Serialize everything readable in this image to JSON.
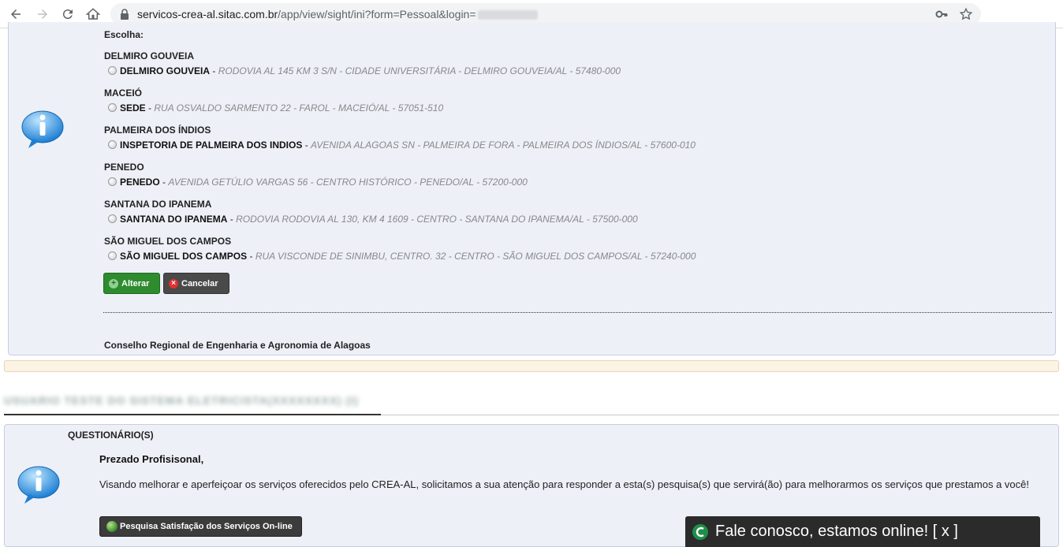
{
  "browser": {
    "url_host": "servicos-crea-al.sitac.com.br",
    "url_path": "/app/view/sight/ini?form=Pessoal&login="
  },
  "selection": {
    "prompt": "Escolha:",
    "groups": [
      {
        "city": "DELMIRO GOUVEIA",
        "name": "DELMIRO GOUVEIA",
        "address": "RODOVIA AL 145 KM 3 S/N - CIDADE UNIVERSITÁRIA - DELMIRO GOUVEIA/AL - 57480-000"
      },
      {
        "city": "MACEIÓ",
        "name": "SEDE",
        "address": "RUA OSVALDO SARMENTO 22 - FAROL - MACEIÓ/AL - 57051-510"
      },
      {
        "city": "PALMEIRA DOS ÍNDIOS",
        "name": "INSPETORIA DE PALMEIRA DOS INDIOS",
        "address": "AVENIDA ALAGOAS SN - PALMEIRA DE FORA - PALMEIRA DOS ÍNDIOS/AL - 57600-010"
      },
      {
        "city": "PENEDO",
        "name": "PENEDO",
        "address": "AVENIDA GETÚLIO VARGAS 56 - CENTRO HISTÓRICO - PENEDO/AL - 57200-000"
      },
      {
        "city": "SANTANA DO IPANEMA",
        "name": "SANTANA DO IPANEMA",
        "address": "RODOVIA RODOVIA AL 130, KM 4 1609 - CENTRO - SANTANA DO IPANEMA/AL - 57500-000"
      },
      {
        "city": "SÃO MIGUEL DOS CAMPOS",
        "name": "SÃO MIGUEL DOS CAMPOS",
        "address": "RUA VISCONDE DE SINIMBU, CENTRO. 32 - CENTRO - SÃO MIGUEL DOS CAMPOS/AL - 57240-000"
      }
    ],
    "separator": " - ",
    "alterar_label": "Alterar",
    "cancelar_label": "Cancelar",
    "footer": "Conselho Regional de Engenharia e Agronomia de Alagoas"
  },
  "blurred_heading": "USUARIO TESTE DO SISTEMA ELETRICISTA(XXXXXXXX) (I)",
  "questionario": {
    "title": "QUESTIONÁRIO(S)",
    "greeting": "Prezado Profisisonal,",
    "body": "Visando melhorar e aperfeiçoar os serviços oferecidos pelo CREA-AL, solicitamos a sua atenção para responder a esta(s) pesquisa(s) que servirá(ão) para melhorarmos os serviços que prestamos a você!",
    "survey_button": "Pesquisa Satisfação dos Serviços On-line"
  },
  "chat": {
    "label": "Fale conosco, estamos online! [ x ]"
  },
  "colors": {
    "panel_bg": "#eef0f8",
    "green_button": "#2e8b2e",
    "dark_button": "#4a4a4a",
    "cream_bar": "#fbf3e4",
    "chat_bg": "#2b2b2b"
  }
}
